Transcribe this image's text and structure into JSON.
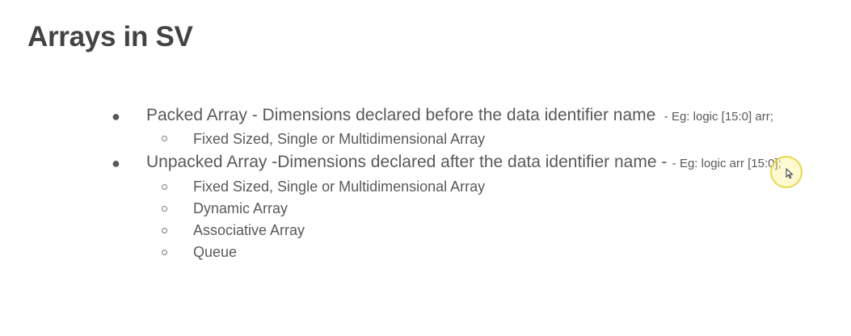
{
  "slide": {
    "title": "Arrays in SV",
    "items": [
      {
        "text": "Packed Array - Dimensions declared before the data identifier name",
        "note": "- Eg: logic [15:0] arr;",
        "sub": [
          "Fixed Sized,  Single or Multidimensional Array"
        ]
      },
      {
        "text": "Unpacked Array -Dimensions declared after the data identifier name  -",
        "note": "- Eg: logic  arr [15:0];",
        "sub": [
          "Fixed Sized, Single or Multidimensional Array",
          "Dynamic Array",
          "Associative Array",
          "Queue"
        ]
      }
    ]
  },
  "colors": {
    "title": "#434343",
    "text": "#595959",
    "cursor_highlight": "#faee78"
  },
  "icons": {
    "bullet": "filled-circle",
    "sub_bullet": "hollow-circle",
    "cursor": "mouse-pointer-icon"
  }
}
